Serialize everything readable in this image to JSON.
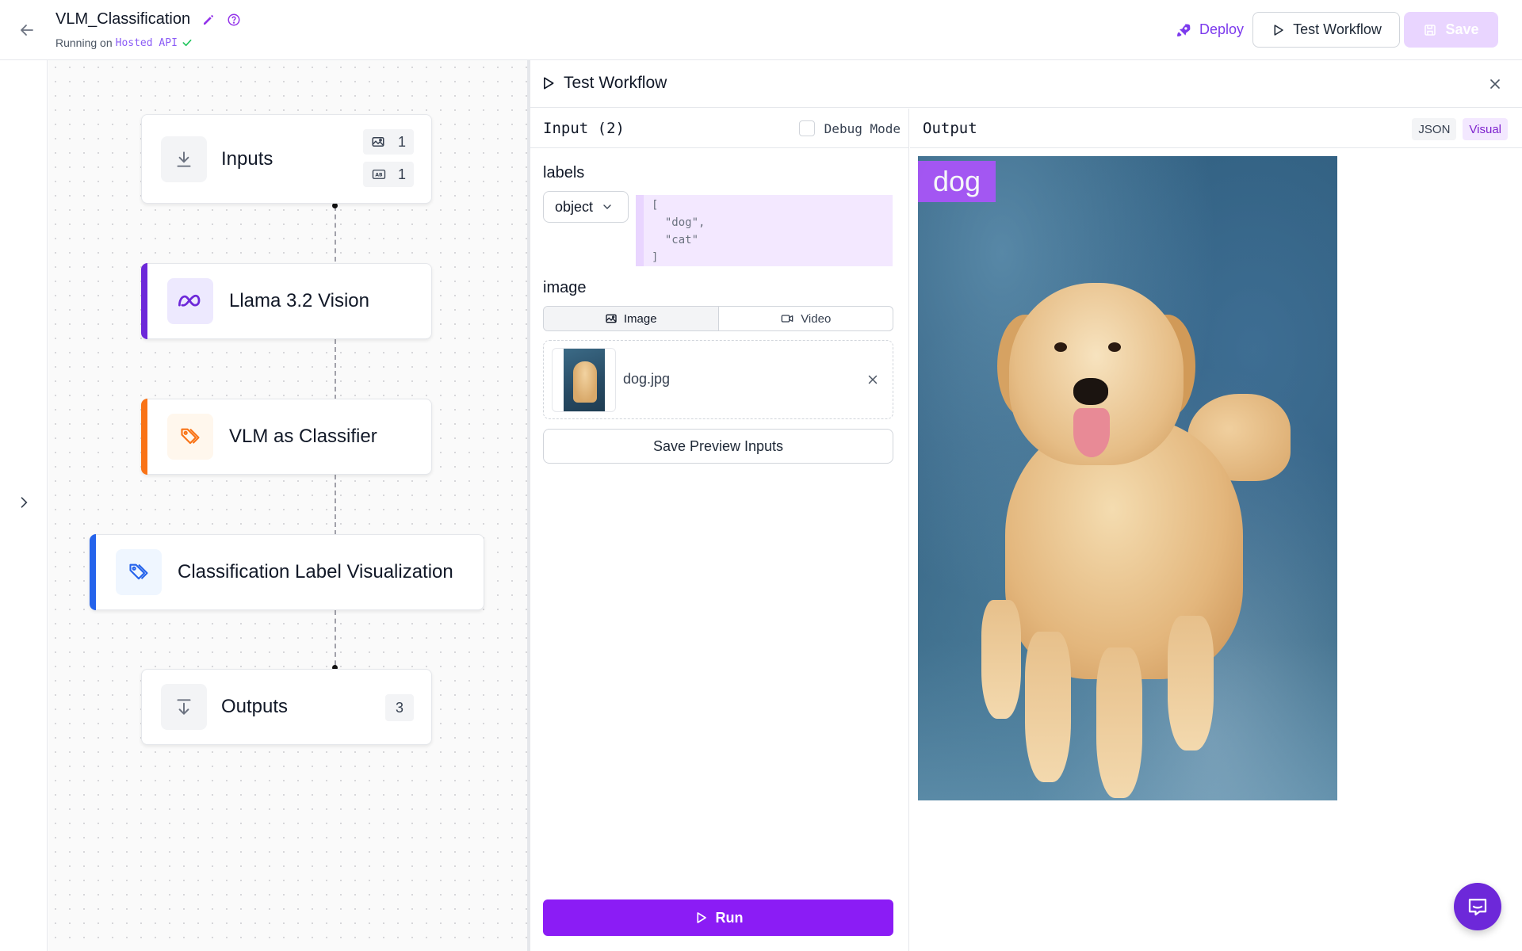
{
  "header": {
    "title": "VLM_Classification",
    "status_prefix": "Running on",
    "status_host": "Hosted API",
    "deploy_label": "Deploy",
    "test_label": "Test Workflow",
    "save_label": "Save"
  },
  "canvas": {
    "nodes": [
      {
        "label": "Inputs",
        "badges": [
          {
            "icon": "image-icon",
            "count": "1"
          },
          {
            "icon": "text-ab-icon",
            "count": "1"
          }
        ]
      },
      {
        "label": "Llama 3.2 Vision",
        "icon": "meta-logo-icon",
        "accent": "#6d28d9"
      },
      {
        "label": "VLM as Classifier",
        "icon": "tag-icon",
        "accent": "#f97316"
      },
      {
        "label": "Classification Label Visualization",
        "icon": "tag-icon",
        "accent": "#2563eb"
      },
      {
        "label": "Outputs",
        "count": "3"
      }
    ]
  },
  "panel": {
    "title": "Test Workflow",
    "input": {
      "title": "Input (2)",
      "debug_label": "Debug Mode",
      "labels_field": "labels",
      "type_select": "object",
      "code_value": "[\n  \"dog\",\n  \"cat\"\n]",
      "image_field": "image",
      "seg_image": "Image",
      "seg_video": "Video",
      "file_name": "dog.jpg",
      "save_preview": "Save Preview Inputs",
      "run_label": "Run"
    },
    "output": {
      "title": "Output",
      "json_label": "JSON",
      "visual_label": "Visual",
      "prediction_label": "dog"
    }
  },
  "colors": {
    "accent": "#7c3aed",
    "run_button": "#8b1cf5",
    "label_box": "#a855f7"
  }
}
